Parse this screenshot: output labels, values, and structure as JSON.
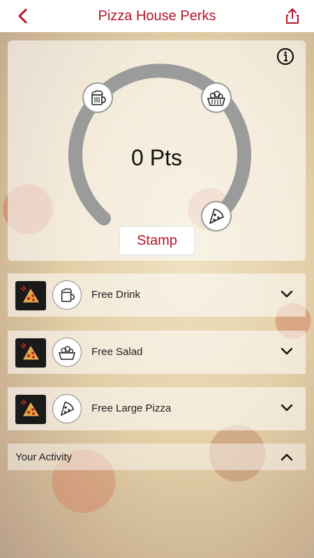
{
  "header": {
    "title": "Pizza House Perks",
    "back_icon": "chevron-left-icon",
    "share_icon": "share-icon"
  },
  "loyalty_card": {
    "points_label": "0 Pts",
    "stamp_label": "Stamp",
    "info_icon": "info-icon",
    "progress_fraction": 0,
    "milestones": [
      {
        "icon": "beer-mug-icon"
      },
      {
        "icon": "salad-basket-icon"
      },
      {
        "icon": "pizza-slice-icon"
      }
    ]
  },
  "rewards": [
    {
      "label": "Free Drink",
      "icon": "beer-mug-icon"
    },
    {
      "label": "Free Salad",
      "icon": "salad-basket-icon"
    },
    {
      "label": "Free Large Pizza",
      "icon": "pizza-slice-icon"
    }
  ],
  "activity": {
    "label": "Your Activity"
  },
  "colors": {
    "accent": "#b5142a",
    "gauge_track": "#9b9b9b"
  }
}
